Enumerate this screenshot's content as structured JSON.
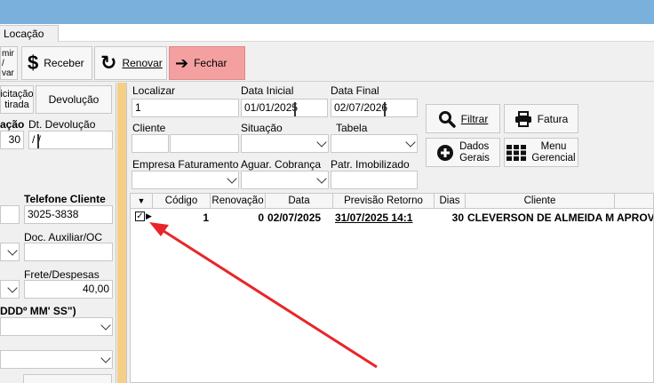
{
  "tabs": {
    "active": "Locação"
  },
  "toolbar": {
    "partial_label": "mir / var",
    "receber": "Receber",
    "renovar": "Renovar",
    "fechar": "Fechar"
  },
  "left": {
    "solicitacao_line1": "icitação",
    "solicitacao_line2": "tirada",
    "devolucao_btn": "Devolução",
    "situacao_label": "ação",
    "dt_devolucao_label": "Dt. Devolução",
    "situacao_value": "30",
    "dt_devolucao_value": " /  /",
    "telefone_label": "Telefone Cliente",
    "telefone_value": "3025-3838",
    "doc_aux_label": "Doc. Auxiliar/OC",
    "doc_aux_value": "",
    "frete_label": "Frete/Despesas",
    "frete_value": "40,00",
    "coord_label": "DDDº MM' SS\")"
  },
  "filters": {
    "localizar_label": "Localizar",
    "localizar_value": "1",
    "data_inicial_label": "Data Inicial",
    "data_inicial_value": "01/01/2025",
    "data_final_label": "Data Final",
    "data_final_value": "02/07/2026",
    "cliente_label": "Cliente",
    "situacao_label": "Situação",
    "tabela_label": "Tabela",
    "empresa_label": "Empresa Faturamento",
    "aguar_label": "Aguar. Cobrança",
    "patr_label": "Patr. Imobilizado"
  },
  "actions": {
    "filtrar": "Filtrar",
    "fatura": "Fatura",
    "dados_gerais_1": "Dados",
    "dados_gerais_2": "Gerais",
    "menu_gerencial_1": "Menu",
    "menu_gerencial_2": "Gerencial"
  },
  "grid": {
    "headers": [
      "▼",
      "Código",
      "Renovação",
      "Data",
      "Previsão Retorno",
      "Dias",
      "Cliente",
      ""
    ],
    "rows": [
      {
        "codigo": "1",
        "renovacao": "0",
        "data": "02/07/2025",
        "previsao": "31/07/2025 14:1",
        "dias": "30",
        "cliente": "CLEVERSON DE ALMEIDA M",
        "extra": "APROV"
      }
    ]
  },
  "annotation": {
    "arrow_color": "#e8262a"
  }
}
